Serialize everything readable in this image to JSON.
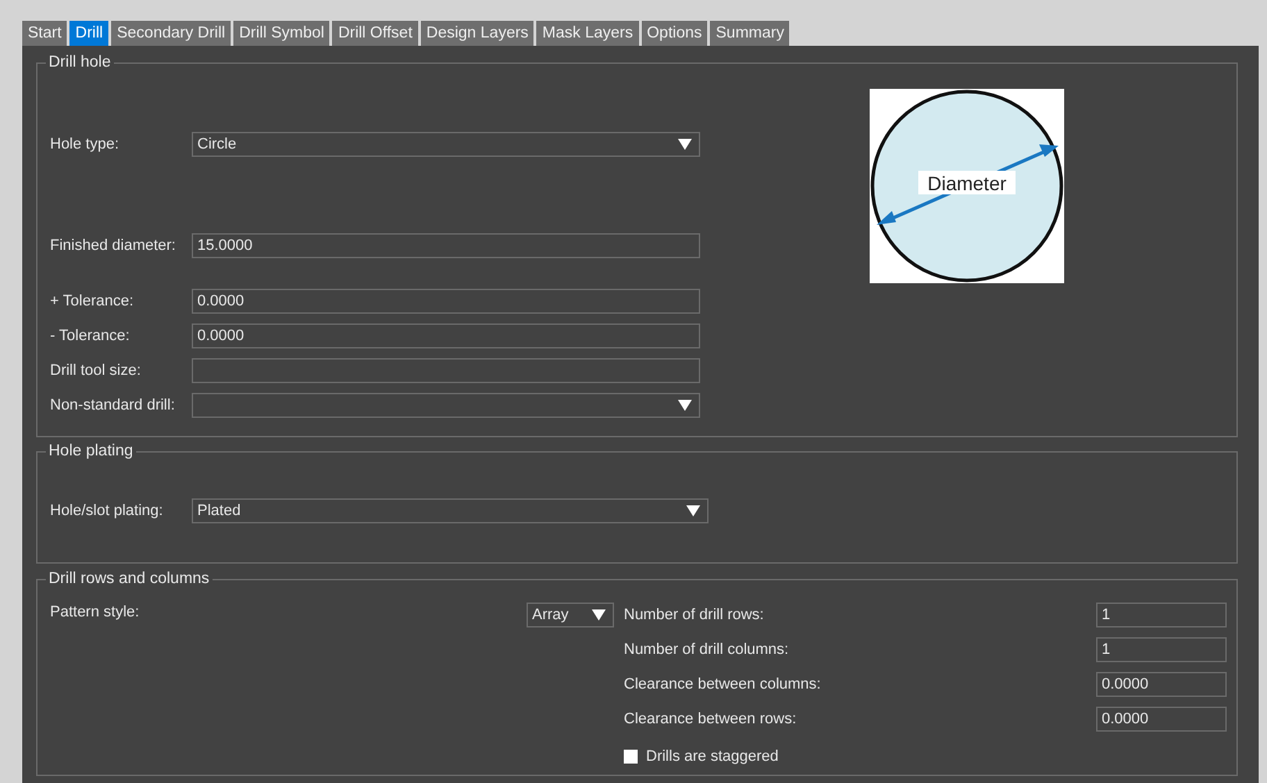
{
  "tabs": [
    {
      "label": "Start",
      "selected": false
    },
    {
      "label": "Drill",
      "selected": true
    },
    {
      "label": "Secondary Drill",
      "selected": false
    },
    {
      "label": "Drill Symbol",
      "selected": false
    },
    {
      "label": "Drill Offset",
      "selected": false
    },
    {
      "label": "Design Layers",
      "selected": false
    },
    {
      "label": "Mask Layers",
      "selected": false
    },
    {
      "label": "Options",
      "selected": false
    },
    {
      "label": "Summary",
      "selected": false
    }
  ],
  "drill_hole": {
    "title": "Drill hole",
    "diagram_label": "Diameter",
    "fields": [
      {
        "label": "Hole type:",
        "value": "Circle",
        "kind": "dropdown"
      },
      {
        "label": "Finished diameter:",
        "value": "15.0000",
        "kind": "text"
      },
      {
        "label": "+ Tolerance:",
        "value": "0.0000",
        "kind": "text"
      },
      {
        "label": "- Tolerance:",
        "value": "0.0000",
        "kind": "text"
      },
      {
        "label": "Drill tool size:",
        "kind": "text"
      },
      {
        "label": "Non-standard drill:",
        "kind": "dropdown"
      }
    ]
  },
  "hole_plating": {
    "title": "Hole plating",
    "fields": [
      {
        "label": "Hole/slot plating:",
        "value": "Plated",
        "kind": "dropdown"
      }
    ]
  },
  "drill_rows_and_columns": {
    "title": "Drill rows and columns",
    "pattern_style": {
      "label": "Pattern style:",
      "value": "Array"
    },
    "fields": [
      {
        "label": "Number of drill rows:",
        "value": "1"
      },
      {
        "label": "Number of drill columns:",
        "value": "1"
      },
      {
        "label": "Clearance between columns:",
        "value": "0.0000"
      },
      {
        "label": "Clearance between rows:",
        "value": "0.0000"
      }
    ],
    "checkbox": {
      "label": "Drills are staggered",
      "checked": false
    }
  }
}
